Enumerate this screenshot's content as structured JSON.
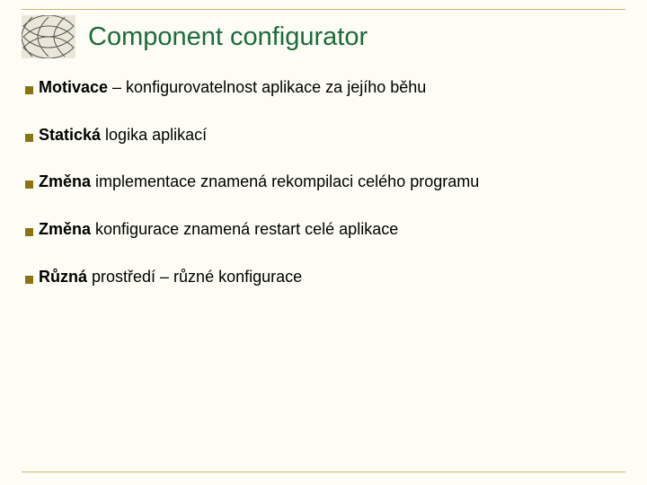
{
  "slide": {
    "title": "Component configurator",
    "items": [
      {
        "bold": "Motivace",
        "rest": " – konfigurovatelnost aplikace za jejího běhu"
      },
      {
        "bold": "Statická",
        "rest": " logika aplikací"
      },
      {
        "bold": "Změna",
        "rest": " implementace znamená rekompilaci celého programu"
      },
      {
        "bold": "Změna",
        "rest": " konfigurace znamená restart celé aplikace"
      },
      {
        "bold": "Různá",
        "rest": " prostředí – různé konfigurace"
      }
    ]
  }
}
